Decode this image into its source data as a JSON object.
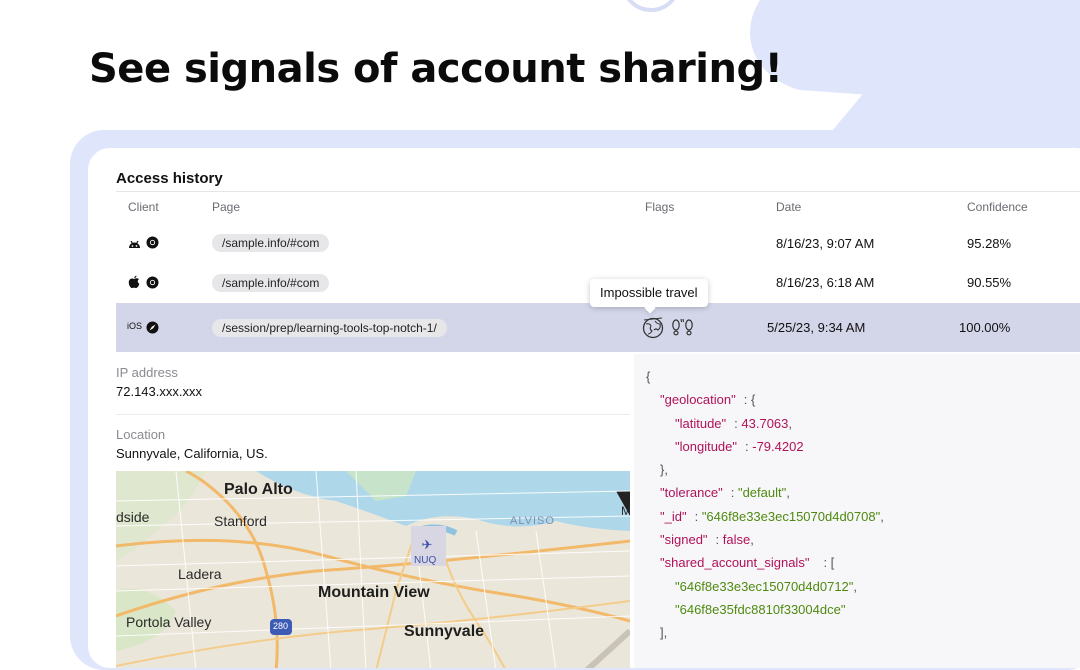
{
  "headline": "See signals of account sharing!",
  "panel": {
    "title": "Access history",
    "columns": {
      "client": "Client",
      "page": "Page",
      "flags": "Flags",
      "date": "Date",
      "confidence": "Confidence"
    },
    "rows": [
      {
        "client_icons": [
          "android-icon",
          "chrome-icon"
        ],
        "page": "/sample.info/#com",
        "date": "8/16/23, 9:07 AM",
        "confidence": "95.28%"
      },
      {
        "client_icons": [
          "apple-icon",
          "chrome-icon"
        ],
        "page": "/sample.info/#com",
        "date": "8/16/23, 6:18 AM",
        "confidence": "90.55%"
      },
      {
        "client_label": "iOS",
        "client_icons": [
          "safari-icon"
        ],
        "page": "/session/prep/learning-tools-top-notch-1/",
        "date": "5/25/23, 9:34 AM",
        "confidence": "100.00%",
        "flags": [
          "globe-travel-icon",
          "footsteps-icon"
        ]
      }
    ],
    "tooltip": "Impossible travel"
  },
  "details": {
    "ip_label": "IP address",
    "ip_value": "72.143.xxx.xxx",
    "location_label": "Location",
    "location_value": "Sunnyvale, California, US."
  },
  "map": {
    "places": [
      "Palo Alto",
      "Stanford",
      "dside",
      "Ladera",
      "Mountain View",
      "Portola Valley",
      "Sunnyvale",
      "ALVISO",
      "NUQ",
      "280",
      "M"
    ]
  },
  "json_lines": [
    "{",
    "\"geolocation\"",
    ": {",
    "\"latitude\"",
    ": ",
    "43.7063",
    ",",
    "\"longitude\"",
    ": ",
    "-79.4202",
    "},",
    "\"tolerance\"",
    ": ",
    "\"default\"",
    ",",
    "\"_id\"",
    ": ",
    "\"646f8e33e3ec15070d4d0708\"",
    ",",
    "\"signed\"",
    ": ",
    "false",
    ",",
    "\"shared_account_signals\"",
    ": [",
    "\"646f8e33e3ec15070d4d0712\"",
    ",",
    "\"646f8e35fdc8810f33004dce\"",
    "],"
  ],
  "colors": {
    "frame": "#dfe6fb",
    "selected_row": "#d3d5e9",
    "json_key": "#b0125a",
    "json_string": "#4f8a10",
    "bg_shape": "#dfe6fb"
  }
}
